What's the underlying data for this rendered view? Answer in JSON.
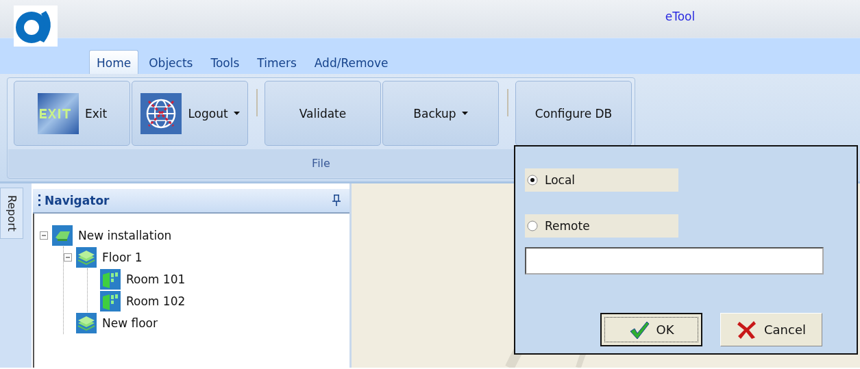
{
  "window": {
    "title": "eTool"
  },
  "tabs": [
    {
      "label": "Home",
      "selected": true
    },
    {
      "label": "Objects",
      "selected": false
    },
    {
      "label": "Tools",
      "selected": false
    },
    {
      "label": "Timers",
      "selected": false
    },
    {
      "label": "Add/Remove",
      "selected": false
    }
  ],
  "ribbon": {
    "group_label": "File",
    "buttons": [
      {
        "label": "Exit",
        "kind": "exit",
        "dropdown": false,
        "separator_before": false
      },
      {
        "label": "Logout",
        "kind": "logout",
        "dropdown": true,
        "separator_before": false
      },
      {
        "label": "Validate",
        "kind": "plain",
        "dropdown": false,
        "separator_before": true
      },
      {
        "label": "Backup",
        "kind": "plain",
        "dropdown": true,
        "separator_before": false
      },
      {
        "label": "Configure DB",
        "kind": "plain",
        "dropdown": false,
        "separator_before": true
      }
    ]
  },
  "side_tab": {
    "label": "Report"
  },
  "navigator": {
    "title": "Navigator",
    "tree": [
      {
        "label": "New installation",
        "kind": "installation",
        "expanded": true,
        "children": [
          {
            "label": "Floor 1",
            "kind": "floor",
            "expanded": true,
            "children": [
              {
                "label": "Room 101",
                "kind": "room"
              },
              {
                "label": "Room 102",
                "kind": "room"
              }
            ]
          },
          {
            "label": "New floor",
            "kind": "floor"
          }
        ]
      }
    ]
  },
  "dialog": {
    "options": [
      {
        "label": "Local",
        "selected": true
      },
      {
        "label": "Remote",
        "selected": false
      }
    ],
    "buttons": [
      {
        "label": "OK",
        "kind": "ok",
        "focused": true
      },
      {
        "label": "Cancel",
        "kind": "cancel",
        "focused": false
      }
    ]
  }
}
